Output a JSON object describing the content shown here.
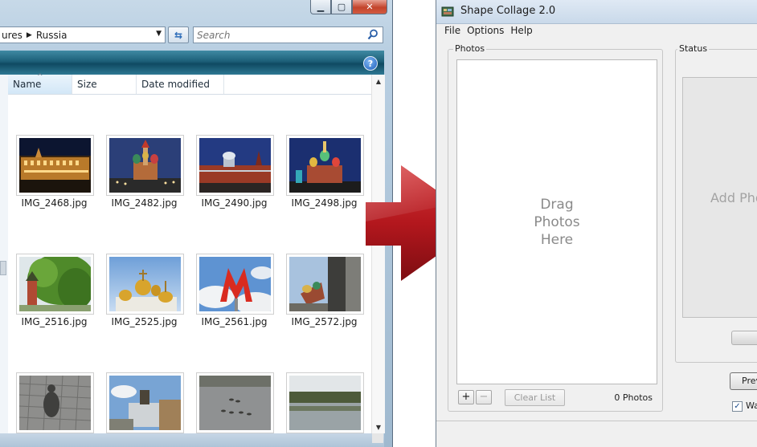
{
  "explorer": {
    "address": {
      "crumb_prev": "ures",
      "crumb_current": "Russia"
    },
    "search": {
      "placeholder": "Search"
    },
    "columns": [
      "Name",
      "Size",
      "Date modified"
    ],
    "files": [
      "IMG_2468.jpg",
      "IMG_2482.jpg",
      "IMG_2490.jpg",
      "IMG_2498.jpg",
      "IMG_2516.jpg",
      "IMG_2525.jpg",
      "IMG_2561.jpg",
      "IMG_2572.jpg"
    ]
  },
  "shape_collage": {
    "title": "Shape Collage 2.0",
    "menu": [
      "File",
      "Options",
      "Help"
    ],
    "photos_group_label": "Photos",
    "drop_hint": "Drag\nPhotos\nHere",
    "add_label": "+",
    "remove_label": "−",
    "clear_list_label": "Clear List",
    "photo_count": "0 Photos",
    "status_group_label": "Status",
    "status_message": "Add Pho",
    "preview_label": "Prev",
    "watch_label": "Wa"
  },
  "colors": {
    "arrow": "#b3171d",
    "explorer_toolbar": "#1c5f78"
  }
}
